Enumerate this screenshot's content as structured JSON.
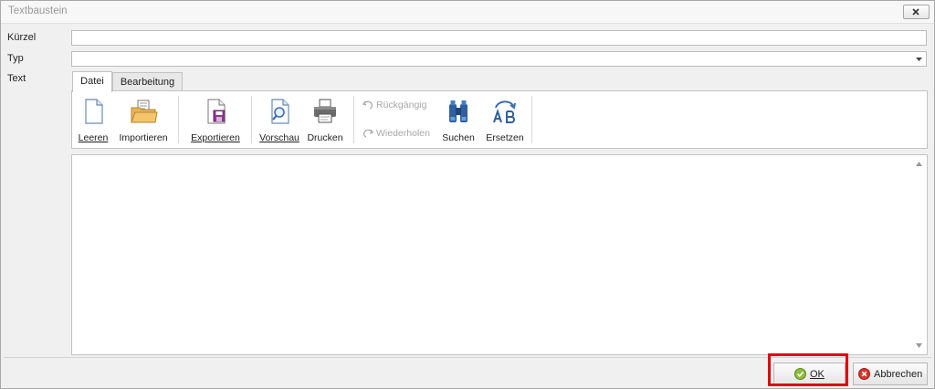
{
  "window": {
    "title": "Textbaustein"
  },
  "fields": {
    "kuerzel": {
      "label": "Kürzel",
      "value": ""
    },
    "typ": {
      "label": "Typ",
      "value": ""
    },
    "text": {
      "label": "Text"
    }
  },
  "tabs": [
    {
      "label": "Datei",
      "active": true
    },
    {
      "label": "Bearbeitung",
      "active": false
    }
  ],
  "ribbon": {
    "leeren": {
      "label": "Leeren",
      "icon": "document-icon"
    },
    "importieren": {
      "label": "Importieren",
      "icon": "import-folder-icon"
    },
    "exportieren": {
      "label": "Exportieren",
      "icon": "export-save-icon"
    },
    "vorschau": {
      "label": "Vorschau",
      "icon": "preview-icon"
    },
    "drucken": {
      "label": "Drucken",
      "icon": "printer-icon"
    },
    "rueckgaengig": {
      "label": "Rückgängig",
      "icon": "undo-icon",
      "enabled": false
    },
    "wiederholen": {
      "label": "Wiederholen",
      "icon": "redo-icon",
      "enabled": false
    },
    "suchen": {
      "label": "Suchen",
      "icon": "binoculars-icon"
    },
    "ersetzen": {
      "label": "Ersetzen",
      "icon": "replace-icon"
    }
  },
  "editor": {
    "value": ""
  },
  "buttons": {
    "ok": {
      "label": "OK",
      "icon": "check-icon"
    },
    "abbrechen": {
      "label": "Abbrechen",
      "icon": "cancel-icon"
    }
  },
  "colors": {
    "highlight": "#e0000c",
    "accent": "#3d6fb0"
  }
}
